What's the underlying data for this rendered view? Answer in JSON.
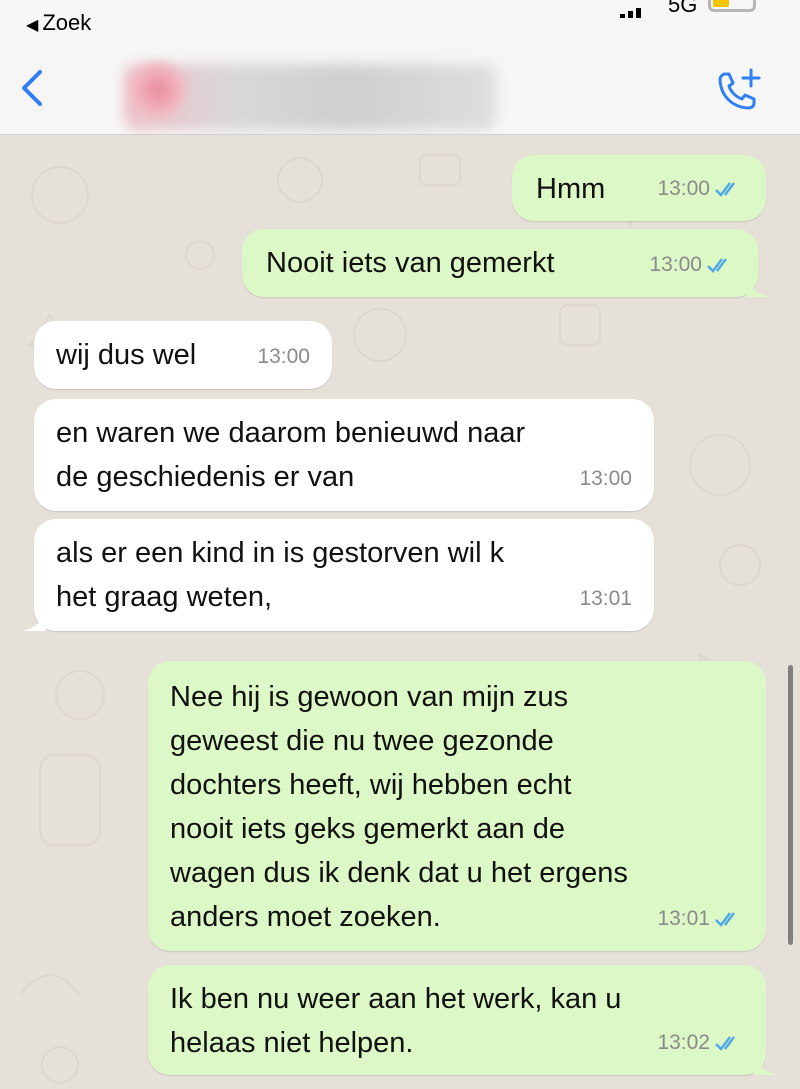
{
  "status": {
    "back_label": "Zoek",
    "network": "5G"
  },
  "header": {
    "contact_name": ""
  },
  "messages": [
    {
      "dir": "out",
      "text": "Hmm",
      "time": "13:00"
    },
    {
      "dir": "out",
      "text": "Nooit iets van gemerkt",
      "time": "13:00"
    },
    {
      "dir": "in",
      "text": "wij dus wel",
      "time": "13:00"
    },
    {
      "dir": "in",
      "text": "en waren we daarom benieuwd naar\nde geschiedenis er van",
      "time": "13:00"
    },
    {
      "dir": "in",
      "text": "als er een kind in is gestorven wil k\nhet graag weten,",
      "time": "13:01"
    },
    {
      "dir": "out",
      "text": "Nee hij is gewoon van mijn zus\ngeweest die nu twee gezonde\ndochters heeft, wij hebben echt\nnooit iets geks gemerkt aan de\nwagen dus ik denk dat u het ergens\nanders moet zoeken.",
      "time": "13:01"
    },
    {
      "dir": "out",
      "text": "Ik ben nu weer aan het werk, kan u\nhelaas niet helpen.",
      "time": "13:02"
    }
  ],
  "colors": {
    "outgoing": "#dcf8c6",
    "incoming": "#ffffff",
    "accent": "#2f7ff5",
    "read_ticks": "#4fa8e8"
  }
}
